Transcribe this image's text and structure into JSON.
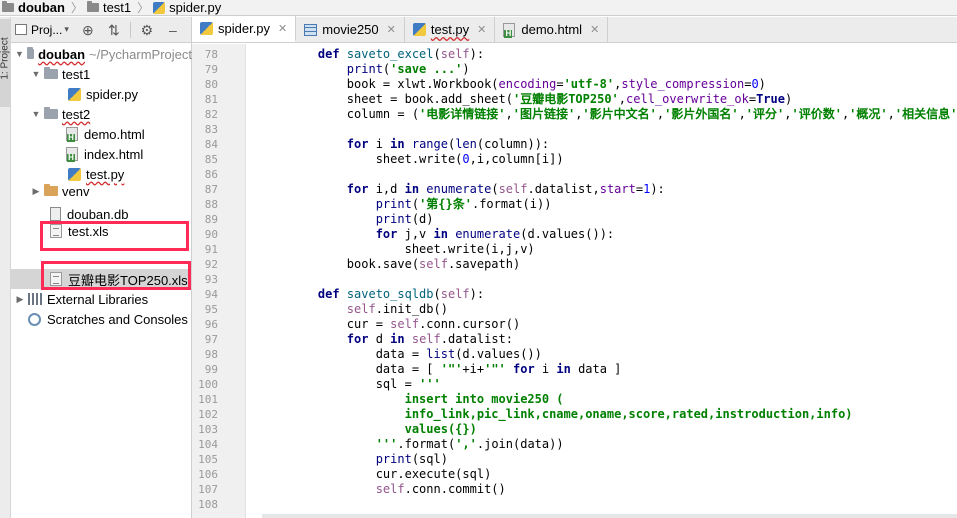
{
  "breadcrumb": {
    "items": [
      "douban",
      "test1",
      "spider.py"
    ]
  },
  "left_strip": {
    "label": "1: Project"
  },
  "project_panel": {
    "title": "Proj...",
    "tree": [
      {
        "label": "douban",
        "hint": "~/PycharmProject"
      },
      {
        "label": "test1"
      },
      {
        "label": "spider.py"
      },
      {
        "label": "test2"
      },
      {
        "label": "demo.html"
      },
      {
        "label": "index.html"
      },
      {
        "label": "test.py"
      },
      {
        "label": "venv"
      },
      {
        "label": "douban.db"
      },
      {
        "label": "test.xls"
      },
      {
        "label": "豆瓣电影TOP250.xls"
      },
      {
        "label": "External Libraries"
      },
      {
        "label": "Scratches and Consoles"
      }
    ]
  },
  "tabs": [
    {
      "label": "spider.py"
    },
    {
      "label": "movie250"
    },
    {
      "label": "test.py"
    },
    {
      "label": "demo.html"
    }
  ],
  "code_lines": [
    {
      "n": "78",
      "indent": "    ",
      "tokens": [
        [
          "kw",
          "def "
        ],
        [
          "fn",
          "saveto_excel"
        ],
        [
          "",
          "("
        ],
        [
          "sf",
          "self"
        ],
        [
          "",
          "):"
        ]
      ]
    },
    {
      "n": "79",
      "indent": "        ",
      "tokens": [
        [
          "bi",
          "print"
        ],
        [
          "",
          "("
        ],
        [
          "st",
          "'save ...'"
        ],
        [
          "",
          ")"
        ]
      ]
    },
    {
      "n": "80",
      "indent": "        ",
      "tokens": [
        [
          "",
          "book = "
        ],
        [
          "",
          "xlwt.Workbook("
        ],
        [
          "pa",
          "encoding"
        ],
        [
          "",
          "="
        ],
        [
          "st",
          "'utf-8'"
        ],
        [
          "",
          ","
        ],
        [
          "pa",
          "style_compression"
        ],
        [
          "",
          "="
        ],
        [
          "nu",
          "0"
        ],
        [
          "",
          ")"
        ]
      ]
    },
    {
      "n": "81",
      "indent": "        ",
      "tokens": [
        [
          "",
          "sheet = book.add_sheet("
        ],
        [
          "st",
          "'豆瓣电影TOP250'"
        ],
        [
          "",
          ","
        ],
        [
          "pa",
          "cell_overwrite_ok"
        ],
        [
          "",
          "="
        ],
        [
          "kw",
          "True"
        ],
        [
          "",
          ")"
        ]
      ]
    },
    {
      "n": "82",
      "indent": "        ",
      "tokens": [
        [
          "",
          "column = ("
        ],
        [
          "st",
          "'电影详情链接'"
        ],
        [
          "",
          ","
        ],
        [
          "st",
          "'图片链接'"
        ],
        [
          "",
          ","
        ],
        [
          "st",
          "'影片中文名'"
        ],
        [
          "",
          ","
        ],
        [
          "st",
          "'影片外国名'"
        ],
        [
          "",
          ","
        ],
        [
          "st",
          "'评分'"
        ],
        [
          "",
          ","
        ],
        [
          "st",
          "'评价数'"
        ],
        [
          "",
          ","
        ],
        [
          "st",
          "'概况'"
        ],
        [
          "",
          ","
        ],
        [
          "st",
          "'相关信息'"
        ],
        [
          "",
          ")"
        ]
      ]
    },
    {
      "n": "83",
      "indent": "",
      "tokens": []
    },
    {
      "n": "84",
      "indent": "        ",
      "tokens": [
        [
          "kw",
          "for "
        ],
        [
          "",
          "i "
        ],
        [
          "kw",
          "in "
        ],
        [
          "bi",
          "range"
        ],
        [
          "",
          "("
        ],
        [
          "bi",
          "len"
        ],
        [
          "",
          "(column)):"
        ]
      ]
    },
    {
      "n": "85",
      "indent": "            ",
      "tokens": [
        [
          "",
          "sheet.write("
        ],
        [
          "nu",
          "0"
        ],
        [
          "",
          ",i,column[i])"
        ]
      ]
    },
    {
      "n": "86",
      "indent": "",
      "tokens": []
    },
    {
      "n": "87",
      "indent": "        ",
      "tokens": [
        [
          "kw",
          "for "
        ],
        [
          "",
          "i,d "
        ],
        [
          "kw",
          "in "
        ],
        [
          "bi",
          "enumerate"
        ],
        [
          "",
          "("
        ],
        [
          "sf",
          "self"
        ],
        [
          "",
          ".datalist,"
        ],
        [
          "pa",
          "start"
        ],
        [
          "",
          "="
        ],
        [
          "nu",
          "1"
        ],
        [
          "",
          "):"
        ]
      ]
    },
    {
      "n": "88",
      "indent": "            ",
      "tokens": [
        [
          "bi",
          "print"
        ],
        [
          "",
          "("
        ],
        [
          "st",
          "'第{}条'"
        ],
        [
          "",
          ".format(i))"
        ]
      ]
    },
    {
      "n": "89",
      "indent": "            ",
      "tokens": [
        [
          "bi",
          "print"
        ],
        [
          "",
          "(d)"
        ]
      ]
    },
    {
      "n": "90",
      "indent": "            ",
      "tokens": [
        [
          "kw",
          "for "
        ],
        [
          "",
          "j,v "
        ],
        [
          "kw",
          "in "
        ],
        [
          "bi",
          "enumerate"
        ],
        [
          "",
          "(d.values()):"
        ]
      ]
    },
    {
      "n": "91",
      "indent": "                ",
      "tokens": [
        [
          "",
          "sheet.write(i,j,v)"
        ]
      ]
    },
    {
      "n": "92",
      "indent": "        ",
      "tokens": [
        [
          "",
          "book.save("
        ],
        [
          "sf",
          "self"
        ],
        [
          "",
          ".savepath)"
        ]
      ]
    },
    {
      "n": "93",
      "indent": "",
      "tokens": []
    },
    {
      "n": "94",
      "indent": "    ",
      "tokens": [
        [
          "kw",
          "def "
        ],
        [
          "fn",
          "saveto_sqldb"
        ],
        [
          "",
          "("
        ],
        [
          "sf",
          "self"
        ],
        [
          "",
          "):"
        ]
      ]
    },
    {
      "n": "95",
      "indent": "        ",
      "tokens": [
        [
          "sf",
          "self"
        ],
        [
          "",
          ".init_db()"
        ]
      ]
    },
    {
      "n": "96",
      "indent": "        ",
      "tokens": [
        [
          "",
          "cur = "
        ],
        [
          "sf",
          "self"
        ],
        [
          "",
          ".conn.cursor()"
        ]
      ]
    },
    {
      "n": "97",
      "indent": "        ",
      "tokens": [
        [
          "kw",
          "for "
        ],
        [
          "",
          "d "
        ],
        [
          "kw",
          "in "
        ],
        [
          "sf",
          "self"
        ],
        [
          "",
          ".datalist:"
        ]
      ]
    },
    {
      "n": "98",
      "indent": "            ",
      "tokens": [
        [
          "",
          "data = "
        ],
        [
          "bi",
          "list"
        ],
        [
          "",
          "(d.values())"
        ]
      ]
    },
    {
      "n": "99",
      "indent": "            ",
      "tokens": [
        [
          "",
          "data = [ "
        ],
        [
          "st",
          "'\"'"
        ],
        [
          "",
          "+i+"
        ],
        [
          "st",
          "'\"'"
        ],
        [
          "",
          ""
        ],
        [
          "kw",
          " for "
        ],
        [
          "",
          "i "
        ],
        [
          "kw",
          "in "
        ],
        [
          "",
          "data ]"
        ]
      ]
    },
    {
      "n": "100",
      "indent": "            ",
      "tokens": [
        [
          "",
          "sql = "
        ],
        [
          "st",
          "'''"
        ]
      ]
    },
    {
      "n": "101",
      "indent": "                ",
      "tokens": [
        [
          "st",
          "insert into movie250 ("
        ]
      ]
    },
    {
      "n": "102",
      "indent": "                ",
      "tokens": [
        [
          "st",
          "info_link,pic_link,cname,oname,score,rated,instroduction,info)"
        ]
      ]
    },
    {
      "n": "103",
      "indent": "                ",
      "tokens": [
        [
          "st",
          "values({})"
        ]
      ]
    },
    {
      "n": "104",
      "indent": "            ",
      "tokens": [
        [
          "st",
          "'''"
        ],
        [
          "",
          ".format("
        ],
        [
          "st",
          "','"
        ],
        [
          "",
          ".join(data))"
        ]
      ]
    },
    {
      "n": "105",
      "indent": "            ",
      "tokens": [
        [
          "bi",
          "print"
        ],
        [
          "",
          "(sql)"
        ]
      ]
    },
    {
      "n": "106",
      "indent": "            ",
      "tokens": [
        [
          "",
          "cur.execute(sql)"
        ]
      ]
    },
    {
      "n": "107",
      "indent": "            ",
      "tokens": [
        [
          "sf",
          "self"
        ],
        [
          "",
          ".conn.commit()"
        ]
      ]
    },
    {
      "n": "108",
      "indent": "",
      "tokens": []
    }
  ]
}
